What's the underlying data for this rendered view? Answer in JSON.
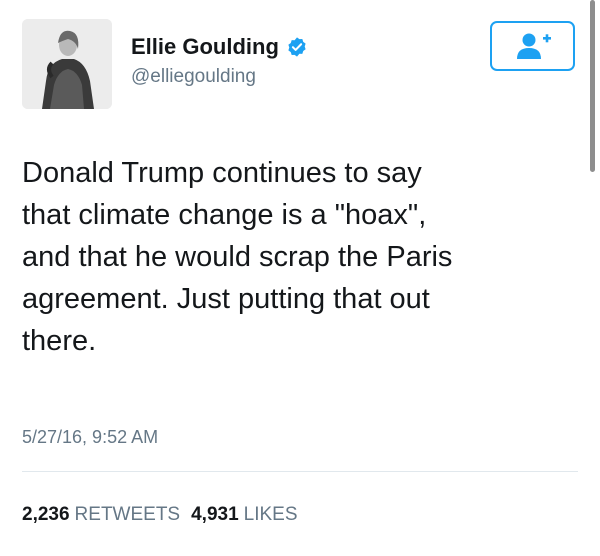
{
  "user": {
    "display_name": "Ellie Goulding",
    "handle": "@elliegoulding",
    "verified": true,
    "verified_icon": "verified-badge-icon",
    "avatar_icon": "profile-photo"
  },
  "follow_button": {
    "icon": "add-user-icon",
    "accent_color": "#1da1f2"
  },
  "tweet": {
    "text_lines": [
      "Donald Trump continues to say",
      "that climate change is a \"hoax\",",
      "and that he would scrap the Paris",
      "agreement. Just putting that out",
      "there."
    ],
    "timestamp": "5/27/16, 9:52 AM"
  },
  "stats": {
    "retweets_count": "2,236",
    "retweets_label": "RETWEETS",
    "likes_count": "4,931",
    "likes_label": "LIKES"
  }
}
